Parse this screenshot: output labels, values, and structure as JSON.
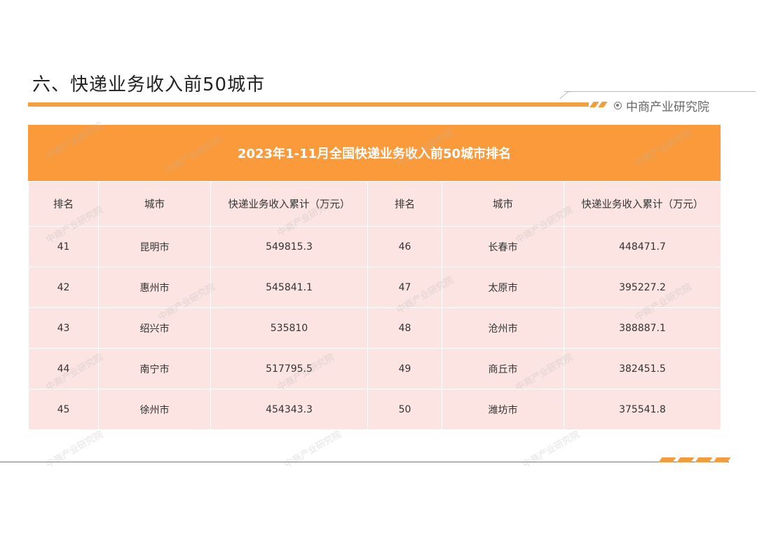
{
  "page": {
    "title": "六、快递业务收入前50城市",
    "brand": "中商产业研究院",
    "watermark": "中商产业研究院"
  },
  "table": {
    "title": "2023年1-11月全国快递业务收入前50城市排名",
    "headers": [
      "排名",
      "城市",
      "快递业务收入累计（万元）",
      "排名",
      "城市",
      "快递业务收入累计（万元）"
    ],
    "rows": [
      [
        "41",
        "昆明市",
        "549815.3",
        "46",
        "长春市",
        "448471.7"
      ],
      [
        "42",
        "惠州市",
        "545841.1",
        "47",
        "太原市",
        "395227.2"
      ],
      [
        "43",
        "绍兴市",
        "535810",
        "48",
        "沧州市",
        "388887.1"
      ],
      [
        "44",
        "南宁市",
        "517795.5",
        "49",
        "商丘市",
        "382451.5"
      ],
      [
        "45",
        "徐州市",
        "454343.3",
        "50",
        "潍坊市",
        "375541.8"
      ]
    ]
  },
  "colors": {
    "accent": "#fb9a3a",
    "cell_bg": "#fbe4e2"
  }
}
